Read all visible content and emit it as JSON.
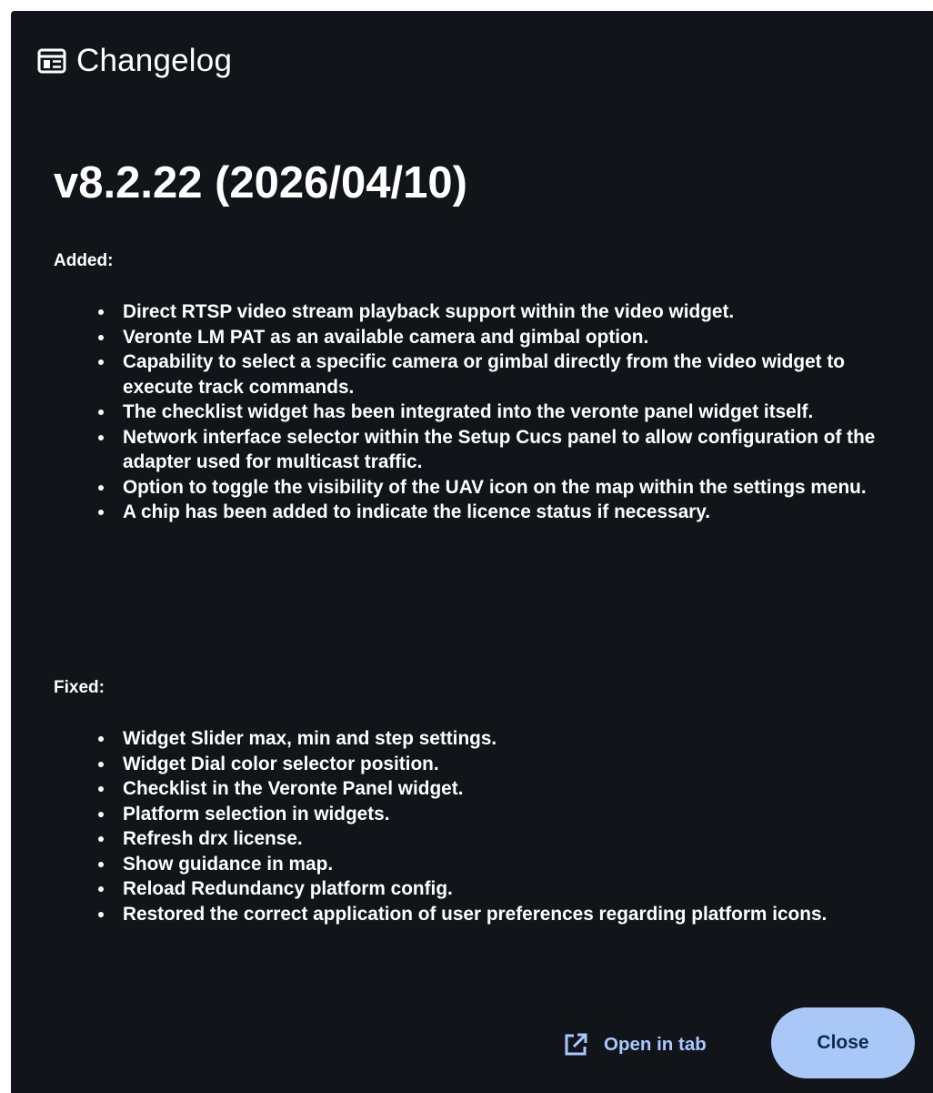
{
  "dialog": {
    "title": "Changelog",
    "icon": "newspaper-icon"
  },
  "changelog": {
    "version_title": "v8.2.22 (2026/04/10)",
    "sections": [
      {
        "label": "Added:",
        "items": [
          "Direct RTSP video stream playback support within the video widget.",
          "Veronte LM PAT as an available camera and gimbal option.",
          "Capability to select a specific camera or gimbal directly from the video widget to execute track commands.",
          "The checklist widget has been integrated into the veronte panel widget itself.",
          "Network interface selector within the Setup Cucs panel to allow configuration of the adapter used for multicast traffic.",
          "Option to toggle the visibility of the UAV icon on the map within the settings menu.",
          "A chip has been added to indicate the licence status if necessary."
        ]
      },
      {
        "label": "Fixed:",
        "items": [
          "Widget Slider max, min and step settings.",
          "Widget Dial color selector position.",
          "Checklist in the Veronte Panel widget.",
          "Platform selection in widgets.",
          "Refresh drx license.",
          "Show guidance in map.",
          "Reload Redundancy platform config.",
          "Restored the correct application of user preferences regarding platform icons."
        ]
      }
    ]
  },
  "footer": {
    "open_in_tab_label": "Open in tab",
    "open_in_tab_icon": "open-in-new-icon",
    "close_label": "Close"
  },
  "colors": {
    "background": "#111418",
    "text": "#ffffff",
    "link": "#a9c8ff",
    "primary_button": "#a9c8f7",
    "primary_button_text": "#0d2950"
  }
}
